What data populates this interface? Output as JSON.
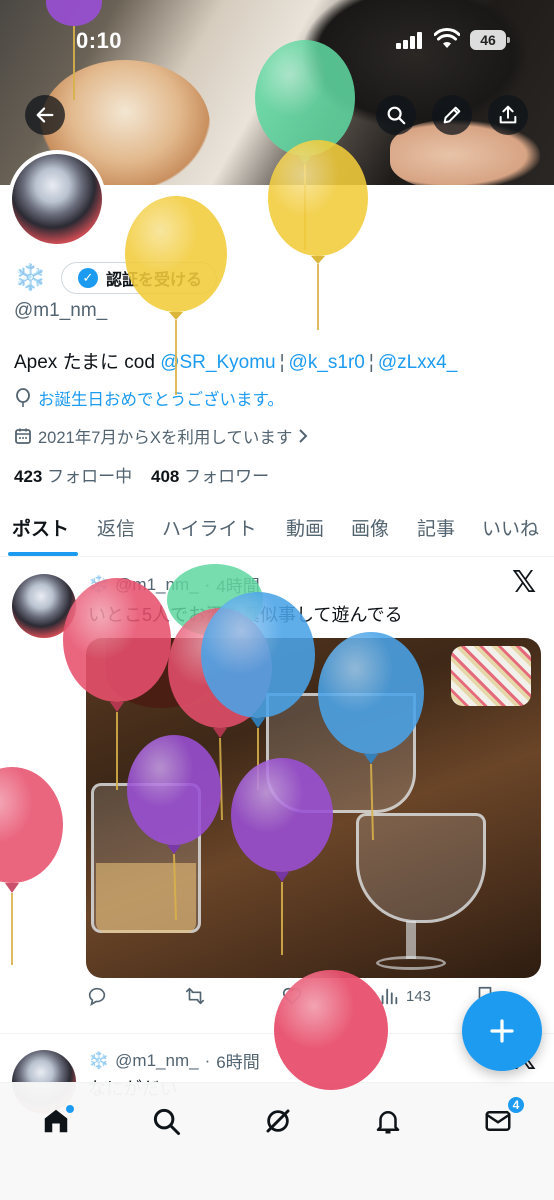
{
  "status_bar": {
    "time": "0:10",
    "battery": "46"
  },
  "header": {
    "back_icon": "arrow-left-icon",
    "search_icon": "search-icon",
    "edit_icon": "pencil-icon",
    "share_icon": "share-upload-icon"
  },
  "profile": {
    "name_emoji": "❄️",
    "verify_label": "認証を受ける",
    "handle": "@m1_nm_",
    "bio_text": "Apex たまに cod ",
    "bio_links": [
      "@SR_Kyomu",
      "@k_s1r0",
      "@zLxx4_"
    ],
    "bio_separator": "¦",
    "birthday": "お誕生日おめでとうございます。",
    "joined": "2021年7月からXを利用しています",
    "following_count": "423",
    "following_label": "フォロー中",
    "followers_count": "408",
    "followers_label": "フォロワー"
  },
  "tabs": [
    "ポスト",
    "返信",
    "ハイライト",
    "動画",
    "画像",
    "記事",
    "いいね"
  ],
  "posts": [
    {
      "emoji": "❄️",
      "handle": "@m1_nm_",
      "time": "4時間",
      "text": "いとこ5人でお酒の真似事して遊んでる",
      "views": "143"
    },
    {
      "emoji": "❄️",
      "handle": "@m1_nm_",
      "time": "6時間",
      "text": "なにがだい"
    }
  ],
  "nav": {
    "messages_badge": "4"
  },
  "colors": {
    "accent": "#1d9bf0",
    "text": "#0f1419",
    "secondary": "#536471",
    "balloon_green": "#5fd6a0",
    "balloon_yellow": "#f2cc3a",
    "balloon_red": "#e8506d",
    "balloon_blue": "#4aa3e8",
    "balloon_purple": "#9a4fd6"
  }
}
